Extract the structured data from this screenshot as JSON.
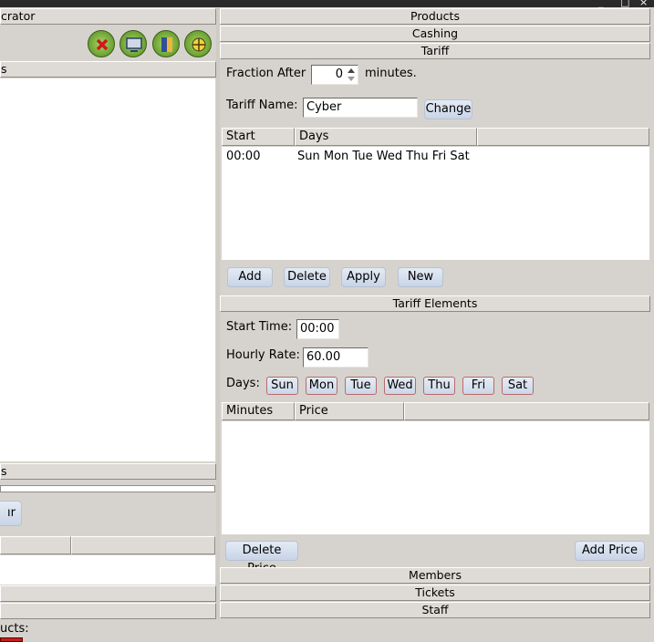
{
  "window": {
    "minimize": "_",
    "restore": "□",
    "close": "×"
  },
  "left_panel": {
    "title_fragment": "crator",
    "list_header_fragment": "s",
    "lower_header_fragment": "s",
    "partial_button": "ır",
    "footer_fragment": "ucts:"
  },
  "toolbar_icons": [
    "close-icon",
    "monitor-icon",
    "book-icon",
    "network-icon"
  ],
  "sections": {
    "products": "Products",
    "cashing": "Cashing",
    "tariff": "Tariff",
    "members": "Members",
    "tickets": "Tickets",
    "staff": "Staff"
  },
  "tariff": {
    "fraction_label": "Fraction After",
    "fraction_value": "0",
    "fraction_unit": "minutes.",
    "name_label": "Tariff Name:",
    "name_value": "Cyber",
    "change_button": "Change",
    "columns": [
      "Start",
      "Days"
    ],
    "rows": [
      {
        "start": "00:00",
        "days": "Sun Mon Tue Wed Thu Fri Sat"
      }
    ],
    "buttons": {
      "add": "Add",
      "delete": "Delete",
      "apply": "Apply",
      "new": "New"
    }
  },
  "elements": {
    "header": "Tariff Elements",
    "start_time_label": "Start Time:",
    "start_time_value": "00:00",
    "hourly_rate_label": "Hourly Rate:",
    "hourly_rate_value": "60.00",
    "days_label": "Days:",
    "days": [
      "Sun",
      "Mon",
      "Tue",
      "Wed",
      "Thu",
      "Fri",
      "Sat"
    ],
    "columns": [
      "Minutes",
      "Price"
    ],
    "delete_price": "Delete Price",
    "add_price": "Add Price"
  },
  "colors": {
    "titlebar": "#2a2a2a",
    "panel": "#d6d3ce",
    "button": "#c8d4e6",
    "day_border": "#b96a6a"
  }
}
